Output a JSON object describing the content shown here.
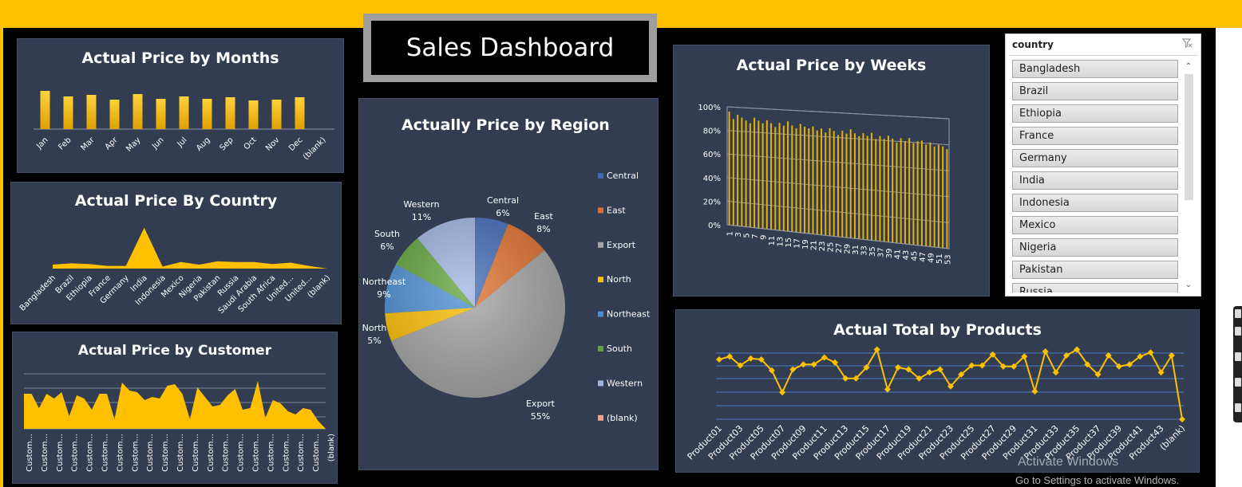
{
  "dashboard_title": "Sales Dashboard",
  "colors": {
    "accent": "#ffc000",
    "panel": "#323d52",
    "background": "#000000",
    "slicer_bg": "#ffffff"
  },
  "months_chart": {
    "title": "Actual Price by  Months"
  },
  "country_chart": {
    "title": "Actual Price By Country"
  },
  "customer_chart": {
    "title": "Actual Price by Customer"
  },
  "region_chart": {
    "title": "Actually Price by Region"
  },
  "weeks_chart": {
    "title": "Actual Price by Weeks"
  },
  "products_chart": {
    "title": "Actual Total  by Products"
  },
  "slicer": {
    "header": "country",
    "clear_filter_icon": "clear-filter-icon",
    "items": [
      "Bangladesh",
      "Brazil",
      "Ethiopia",
      "France",
      "Germany",
      "India",
      "Indonesia",
      "Mexico",
      "Nigeria",
      "Pakistan",
      "Russia"
    ]
  },
  "watermark": {
    "line1": "Activate Windows",
    "line2": "Go to Settings to activate Windows."
  },
  "chart_data": [
    {
      "type": "bar",
      "id": "months",
      "title": "Actual Price by  Months",
      "categories": [
        "Jan",
        "Feb",
        "Mar",
        "Apr",
        "May",
        "Jun",
        "Jul",
        "Aug",
        "Sep",
        "Oct",
        "Nov",
        "Dec",
        "(blank)"
      ],
      "values": [
        48,
        41,
        43,
        37,
        44,
        38,
        41,
        38,
        40,
        36,
        37,
        40,
        0
      ],
      "ylim": [
        0,
        60
      ],
      "grid": false,
      "legend": "none"
    },
    {
      "type": "area",
      "id": "country",
      "title": "Actual Price By Country",
      "categories": [
        "Bangladesh",
        "Brazil",
        "Ethiopia",
        "France",
        "Germany",
        "India",
        "Indonesia",
        "Mexico",
        "Nigeria",
        "Pakistan",
        "Russia",
        "Saudi Arabia",
        "South Africa",
        "United...",
        "United...",
        "(blank)"
      ],
      "values": [
        6,
        8,
        7,
        4,
        4,
        62,
        3,
        10,
        6,
        11,
        10,
        10,
        7,
        9,
        4,
        0
      ],
      "ylim": [
        0,
        70
      ],
      "grid": false,
      "legend": "none"
    },
    {
      "type": "area",
      "id": "customer",
      "title": "Actual Price by Customer",
      "categories": [
        "Custom...",
        "Custom...",
        "Custom...",
        "Custom...",
        "Custom...",
        "Custom...",
        "Custom...",
        "Custom...",
        "Custom...",
        "Custom...",
        "Custom...",
        "Custom...",
        "Custom...",
        "Custom...",
        "Custom...",
        "Custom...",
        "Custom...",
        "Custom...",
        "Custom...",
        "Custom...",
        "(blank)"
      ],
      "values": [
        44,
        44,
        26,
        44,
        38,
        46,
        16,
        42,
        38,
        24,
        44,
        44,
        12,
        58,
        48,
        46,
        36,
        40,
        38,
        54,
        56,
        44,
        12,
        52,
        40,
        28,
        30,
        42,
        50,
        24,
        26,
        60,
        14,
        36,
        32,
        22,
        18,
        26,
        24,
        10,
        0
      ],
      "ylim": [
        0,
        70
      ],
      "grid": true,
      "legend": "none"
    },
    {
      "type": "pie",
      "id": "region",
      "title": "Actually Price by Region",
      "categories": [
        "Central",
        "East",
        "Export",
        "North",
        "Northeast",
        "South",
        "Western",
        "(blank)"
      ],
      "values": [
        6,
        8,
        55,
        5,
        9,
        6,
        11,
        0
      ],
      "labels": [
        "6%",
        "8%",
        "55%",
        "5%",
        "9%",
        "6%",
        "11%"
      ],
      "colors": [
        "#3f69b5",
        "#e0702c",
        "#a5a5a5",
        "#ffc000",
        "#4a8fd4",
        "#5fa43a",
        "#9eb4e2",
        "#f4a28c"
      ],
      "legend_entries": [
        "Central",
        "East",
        "Export",
        "North",
        "Northeast",
        "South",
        "Western",
        "(blank)"
      ],
      "legend": "right"
    },
    {
      "type": "bar",
      "id": "weeks",
      "title": "Actual Price by Weeks",
      "categories": [
        "1",
        "3",
        "5",
        "7",
        "9",
        "11",
        "13",
        "15",
        "17",
        "19",
        "21",
        "23",
        "25",
        "27",
        "29",
        "31",
        "33",
        "35",
        "37",
        "39",
        "41",
        "43",
        "45",
        "47",
        "49",
        "51",
        "53"
      ],
      "values": [
        96,
        90,
        94,
        92,
        90,
        88,
        93,
        91,
        89,
        92,
        90,
        87,
        91,
        89,
        93,
        90,
        88,
        92,
        90,
        89,
        91,
        88,
        90,
        87,
        91,
        89,
        86,
        90,
        88,
        92,
        89,
        87,
        90,
        88,
        91,
        86,
        89,
        87,
        90,
        88,
        85,
        89,
        87,
        90,
        86,
        88,
        89,
        86,
        88,
        85,
        87,
        86,
        84
      ],
      "yticks": [
        "0%",
        "20%",
        "40%",
        "60%",
        "80%",
        "100%"
      ],
      "ylim": [
        0,
        100
      ],
      "grid": true,
      "legend": "none"
    },
    {
      "type": "line",
      "id": "products",
      "title": "Actual Total  by Products",
      "categories": [
        "Product01",
        "Product03",
        "Product05",
        "Product07",
        "Product09",
        "Product11",
        "Product13",
        "Product15",
        "Product17",
        "Product19",
        "Product21",
        "Product23",
        "Product25",
        "Product27",
        "Product29",
        "Product31",
        "Product33",
        "Product35",
        "Product37",
        "Product39",
        "Product41",
        "Product43",
        "(blank)"
      ],
      "values": [
        60,
        63,
        54,
        61,
        60,
        49,
        27,
        50,
        55,
        55,
        62,
        57,
        41,
        41,
        52,
        70,
        30,
        52,
        50,
        41,
        47,
        50,
        33,
        45,
        54,
        54,
        65,
        53,
        53,
        63,
        28,
        68,
        47,
        64,
        70,
        55,
        45,
        64,
        53,
        55,
        63,
        67,
        47,
        64,
        0
      ],
      "ylim": [
        0,
        80
      ],
      "grid": true,
      "legend": "none"
    }
  ]
}
